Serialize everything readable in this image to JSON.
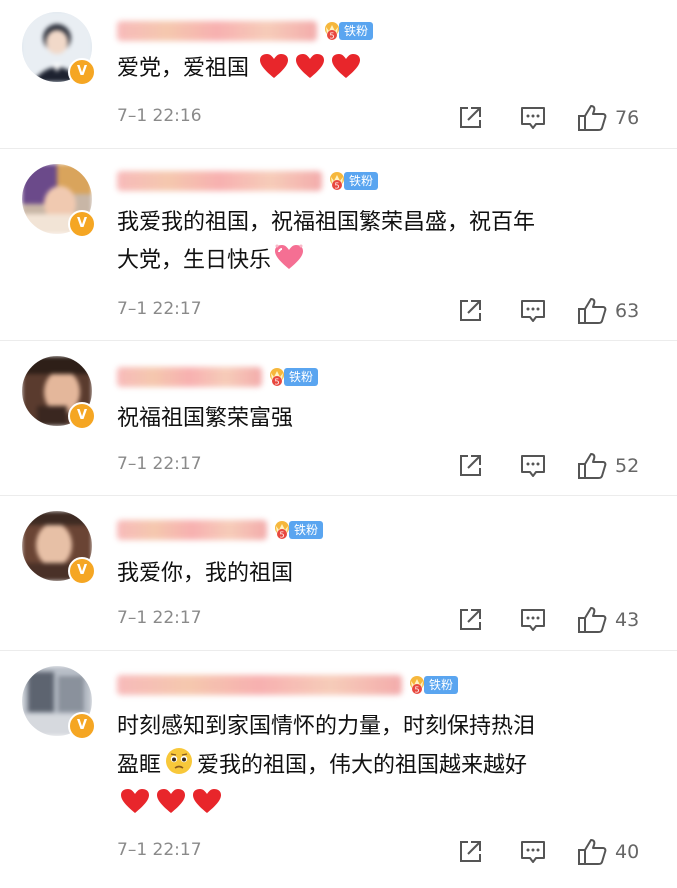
{
  "fan_badge_label": "铁粉",
  "fan_badge_level": "5",
  "verified_mark": "V",
  "comments": [
    {
      "text": "爱党，爱祖国",
      "emoji_after": [
        "heart",
        "heart",
        "heart"
      ],
      "time": "7–1 22:16",
      "likes": "76"
    },
    {
      "text_line1": "我爱我的祖国，祝福祖国繁荣昌盛，祝百年",
      "text_line2": "大党，生日快乐",
      "time": "7–1 22:17",
      "likes": "63"
    },
    {
      "text": "祝福祖国繁荣富强",
      "time": "7–1 22:17",
      "likes": "52"
    },
    {
      "text": "我爱你，我的祖国",
      "time": "7–1 22:17",
      "likes": "43"
    },
    {
      "text_line1": "时刻感知到家国情怀的力量，时刻保持热泪",
      "text_line2a": "盈眶",
      "text_line2b": "爱我的祖国，伟大的祖国越来越好",
      "time": "7–1 22:17",
      "likes": "40"
    }
  ],
  "icons": {
    "share": "share-icon",
    "comment": "comment-icon",
    "like": "thumbs-up-icon"
  },
  "colors": {
    "heart": "#e8262b",
    "fan_badge": "#5aa5f0",
    "verified": "#f5a623",
    "meta": "#8a8a8a"
  }
}
